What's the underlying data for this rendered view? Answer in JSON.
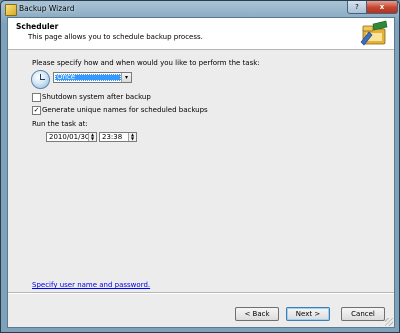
{
  "window": {
    "title": "Backup Wizard",
    "help_label": "?",
    "close_label": "x"
  },
  "header": {
    "title": "Scheduler",
    "subtitle": "This page allows you to schedule backup process."
  },
  "form": {
    "prompt": "Please specify how and when would you like to perform the task:",
    "frequency": {
      "value": "Once",
      "arrow": "▾"
    },
    "shutdown": {
      "label": "Shutdown system after backup",
      "checked": false,
      "mark": ""
    },
    "unique_names": {
      "label": "Generate unique names for scheduled backups",
      "checked": true,
      "mark": "✓"
    },
    "run_label": "Run the task at:",
    "date": "2010/01/30",
    "time": "23:38",
    "spin_up": "▲",
    "spin_down": "▼"
  },
  "link": "Specify user name and password.",
  "buttons": {
    "back": "< Back",
    "next": "Next >",
    "cancel": "Cancel"
  },
  "colors": {
    "link": "#0000ee",
    "selection": "#3399ff",
    "close": "#c4452f"
  },
  "icons": [
    "app-icon",
    "help-icon",
    "close-icon",
    "wizard-icon",
    "clock-icon",
    "dropdown-arrow-icon",
    "spinner-icon",
    "resize-grip-icon"
  ]
}
